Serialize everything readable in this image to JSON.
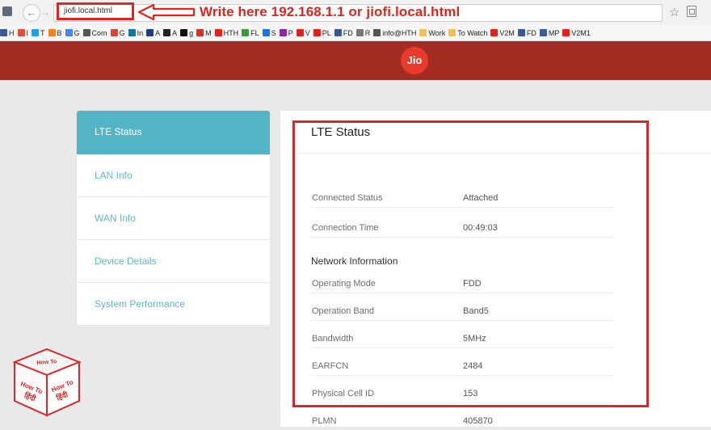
{
  "browser": {
    "url": "jiofi.local.html",
    "annotation": "Write here 192.168.1.1 or jiofi.local.html",
    "bookmarks": [
      {
        "label": "H",
        "color": "#3b5998"
      },
      {
        "label": "I",
        "color": "#e04e39"
      },
      {
        "label": "T",
        "color": "#1da1f2"
      },
      {
        "label": "B",
        "color": "#f58220"
      },
      {
        "label": "G",
        "color": "#4285f4"
      },
      {
        "label": "Com",
        "color": "#555555"
      },
      {
        "label": "G",
        "color": "#db4437"
      },
      {
        "label": "In",
        "color": "#0e76a8"
      },
      {
        "label": "A",
        "color": "#1e3a8a"
      },
      {
        "label": "A",
        "color": "#222222"
      },
      {
        "label": "g",
        "color": "#111111"
      },
      {
        "label": "M",
        "color": "#d93025"
      },
      {
        "label": "HTH",
        "color": "#e62117"
      },
      {
        "label": "FL",
        "color": "#3c9a3c"
      },
      {
        "label": "S",
        "color": "#1a73e8"
      },
      {
        "label": "P",
        "color": "#8e24aa"
      },
      {
        "label": "V",
        "color": "#e62117"
      },
      {
        "label": "PL",
        "color": "#e62117"
      },
      {
        "label": "FD",
        "color": "#3b5998"
      },
      {
        "label": "R",
        "color": "#777777"
      },
      {
        "label": "info@HTH",
        "color": "#555555"
      },
      {
        "label": "Work",
        "color": "#f2c14e"
      },
      {
        "label": "To Watch",
        "color": "#f2c14e"
      },
      {
        "label": "V2M",
        "color": "#e62117"
      },
      {
        "label": "FD",
        "color": "#3b5998"
      },
      {
        "label": "MP",
        "color": "#3b5998"
      },
      {
        "label": "V2M1",
        "color": "#e62117"
      }
    ]
  },
  "header": {
    "logo_text": "Jio",
    "brand_color": "#a32d23"
  },
  "sidebar": {
    "items": [
      {
        "label": "LTE Status",
        "active": true
      },
      {
        "label": "LAN Info",
        "active": false
      },
      {
        "label": "WAN Info",
        "active": false
      },
      {
        "label": "Device Details",
        "active": false
      },
      {
        "label": "System Performance",
        "active": false
      }
    ]
  },
  "main": {
    "title": "LTE Status",
    "connection": [
      {
        "label": "Connected Status",
        "value": "Attached"
      },
      {
        "label": "Connection Time",
        "value": "00:49:03"
      }
    ],
    "network_heading": "Network Information",
    "network": [
      {
        "label": "Operating Mode",
        "value": "FDD"
      },
      {
        "label": "Operation Band",
        "value": "Band5"
      },
      {
        "label": "Bandwidth",
        "value": "5MHz"
      },
      {
        "label": "EARFCN",
        "value": "2484"
      },
      {
        "label": "Physical Cell ID",
        "value": "153"
      },
      {
        "label": "PLMN",
        "value": "405870"
      }
    ]
  },
  "watermark": {
    "text_top": "How To",
    "text_hindi": "हिंदी",
    "accent_color": "#d9262c"
  }
}
